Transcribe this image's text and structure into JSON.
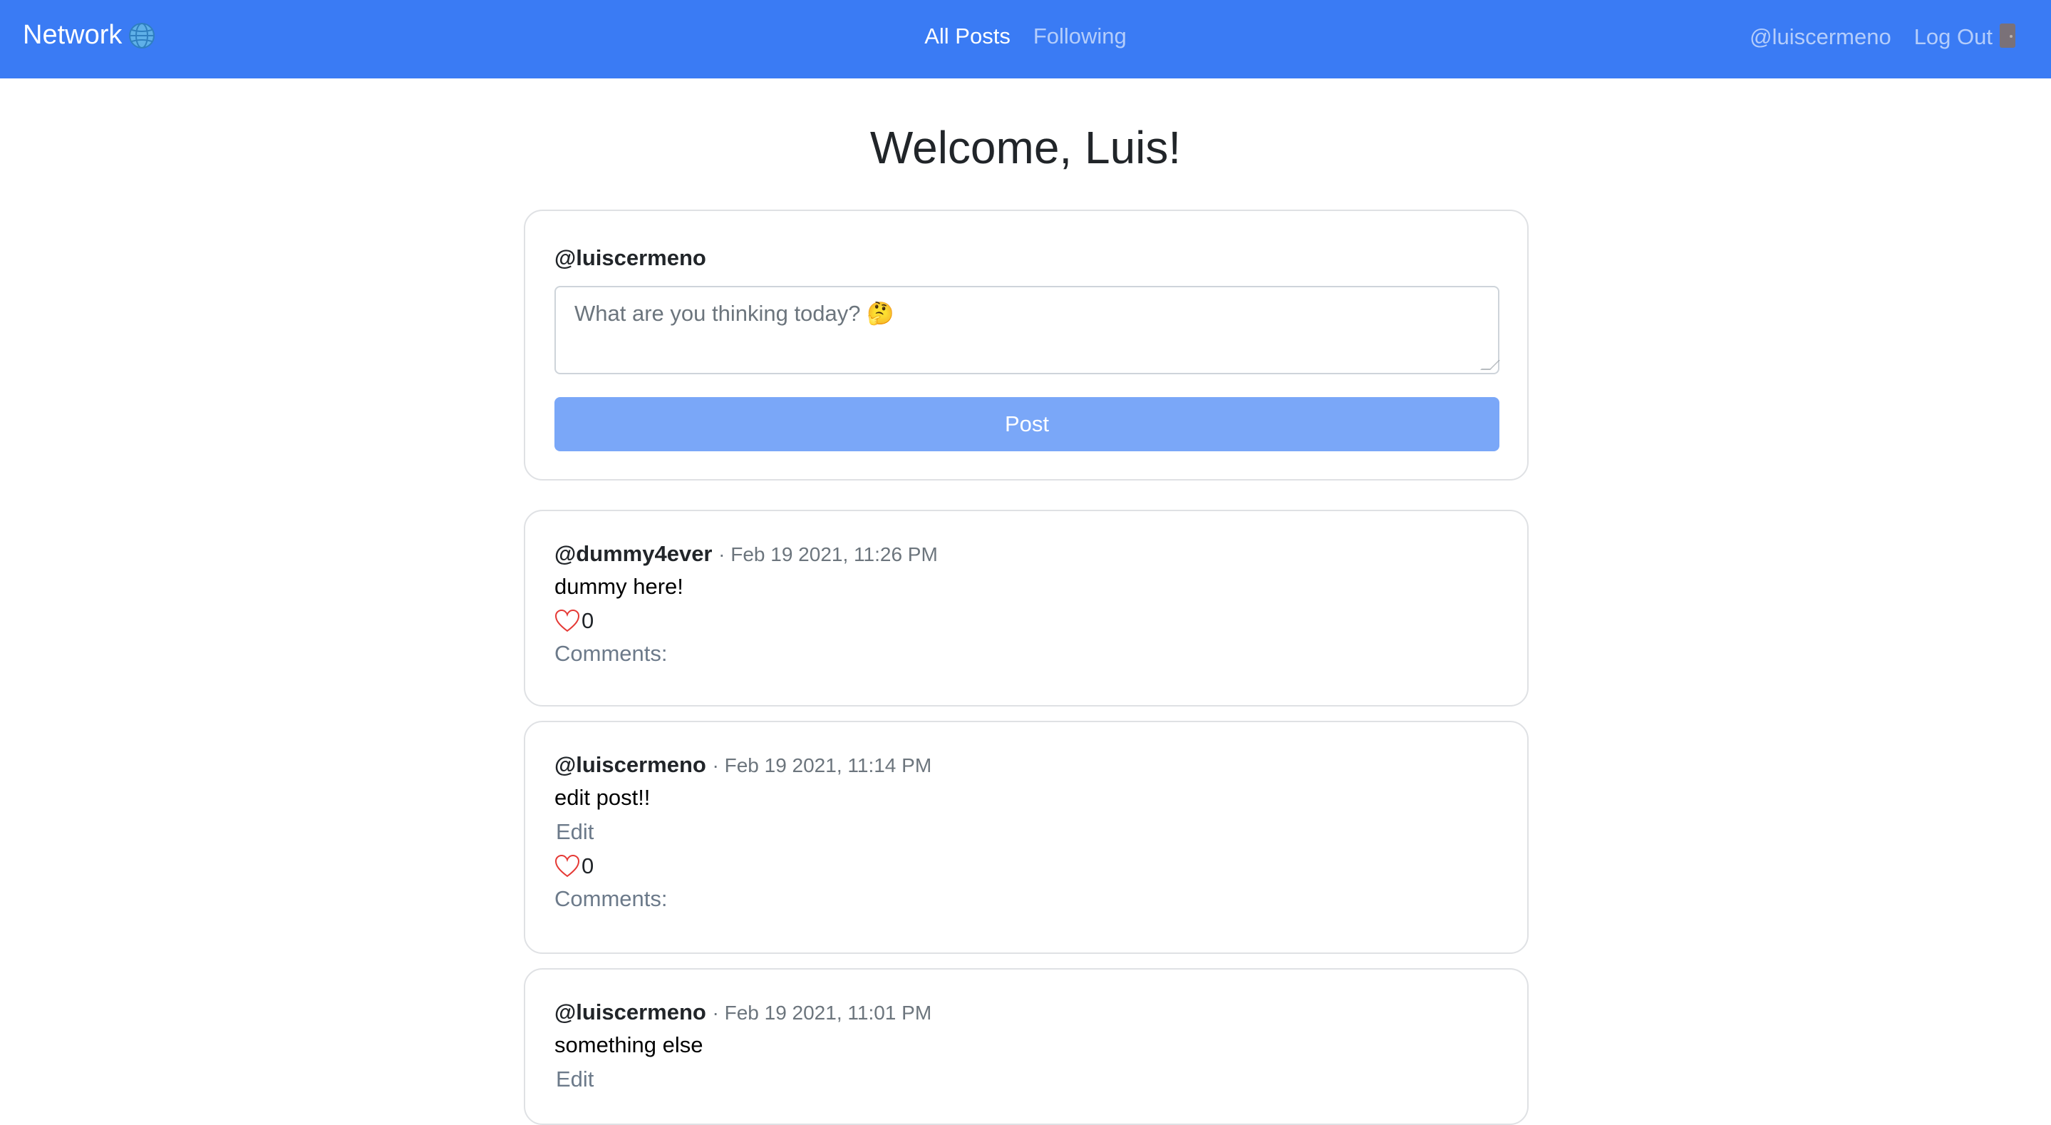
{
  "navbar": {
    "brand": "Network",
    "brand_icon": "globe-icon",
    "links": [
      {
        "label": "All Posts",
        "active": true
      },
      {
        "label": "Following",
        "active": false
      }
    ],
    "user": "@luiscermeno",
    "logout": "Log Out",
    "logout_icon": "door-icon",
    "background_color": "#3a7bf4"
  },
  "page": {
    "title": "Welcome, Luis!"
  },
  "compose": {
    "username": "@luiscermeno",
    "placeholder": "What are you thinking today? 🤔",
    "post_label": "Post",
    "post_button_color": "#7aa7f8"
  },
  "posts": [
    {
      "author": "@dummy4ever",
      "meta": "· Feb 19 2021, 11:26 PM",
      "body": "dummy here!",
      "editable": false,
      "likes": "0",
      "comments_label": "Comments:"
    },
    {
      "author": "@luiscermeno",
      "meta": "· Feb 19 2021, 11:14 PM",
      "body": "edit post!!",
      "editable": true,
      "edit_label": "Edit",
      "likes": "0",
      "comments_label": "Comments:"
    },
    {
      "author": "@luiscermeno",
      "meta": "· Feb 19 2021, 11:01 PM",
      "body": "something else",
      "editable": true,
      "edit_label": "Edit"
    }
  ]
}
